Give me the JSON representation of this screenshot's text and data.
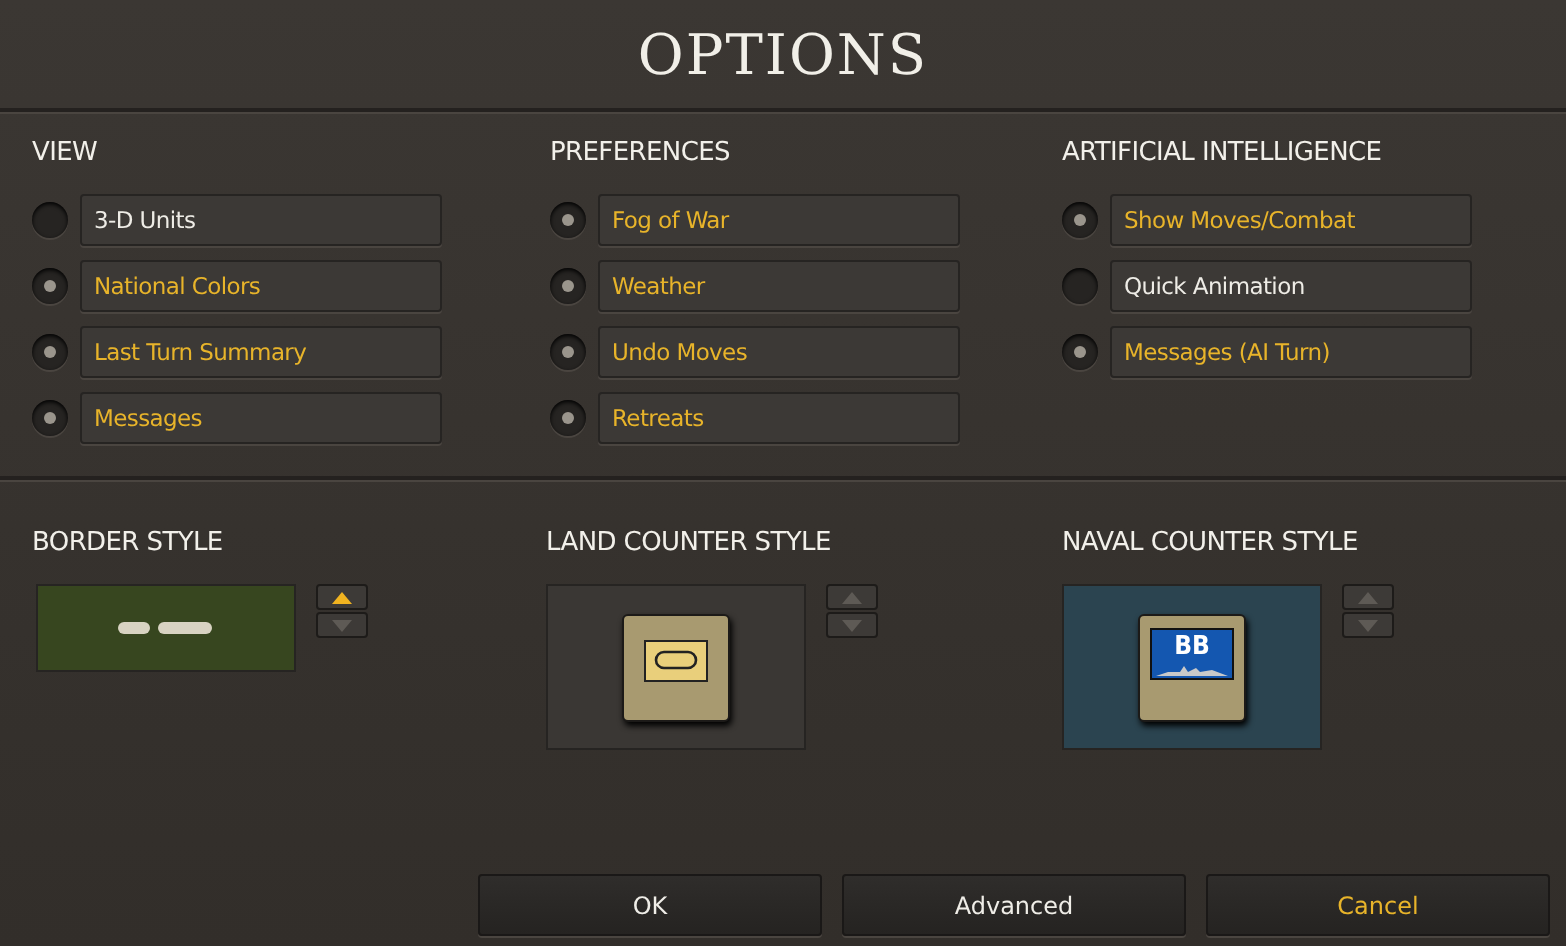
{
  "window": {
    "title": "OPTIONS"
  },
  "groups": [
    {
      "title": "VIEW",
      "options": [
        {
          "label": "3-D Units",
          "checked": false
        },
        {
          "label": "National Colors",
          "checked": true
        },
        {
          "label": "Last Turn Summary",
          "checked": true
        },
        {
          "label": "Messages",
          "checked": true
        }
      ]
    },
    {
      "title": "PREFERENCES",
      "options": [
        {
          "label": "Fog of War",
          "checked": true
        },
        {
          "label": "Weather",
          "checked": true
        },
        {
          "label": "Undo Moves",
          "checked": true
        },
        {
          "label": "Retreats",
          "checked": true
        }
      ]
    },
    {
      "title": "ARTIFICIAL INTELLIGENCE",
      "options": [
        {
          "label": "Show Moves/Combat",
          "checked": true
        },
        {
          "label": "Quick Animation",
          "checked": false
        },
        {
          "label": "Messages (AI Turn)",
          "checked": true
        }
      ]
    }
  ],
  "styles": [
    {
      "title": "BORDER STYLE",
      "kind": "border",
      "up_enabled": true,
      "down_enabled": false
    },
    {
      "title": "LAND COUNTER STYLE",
      "kind": "land",
      "up_enabled": false,
      "down_enabled": false
    },
    {
      "title": "NAVAL COUNTER STYLE",
      "kind": "naval",
      "up_enabled": false,
      "down_enabled": false,
      "badge": "BB"
    }
  ],
  "buttons": [
    {
      "label": "OK",
      "highlighted": false
    },
    {
      "label": "Advanced",
      "highlighted": false
    },
    {
      "label": "Cancel",
      "highlighted": true
    }
  ]
}
